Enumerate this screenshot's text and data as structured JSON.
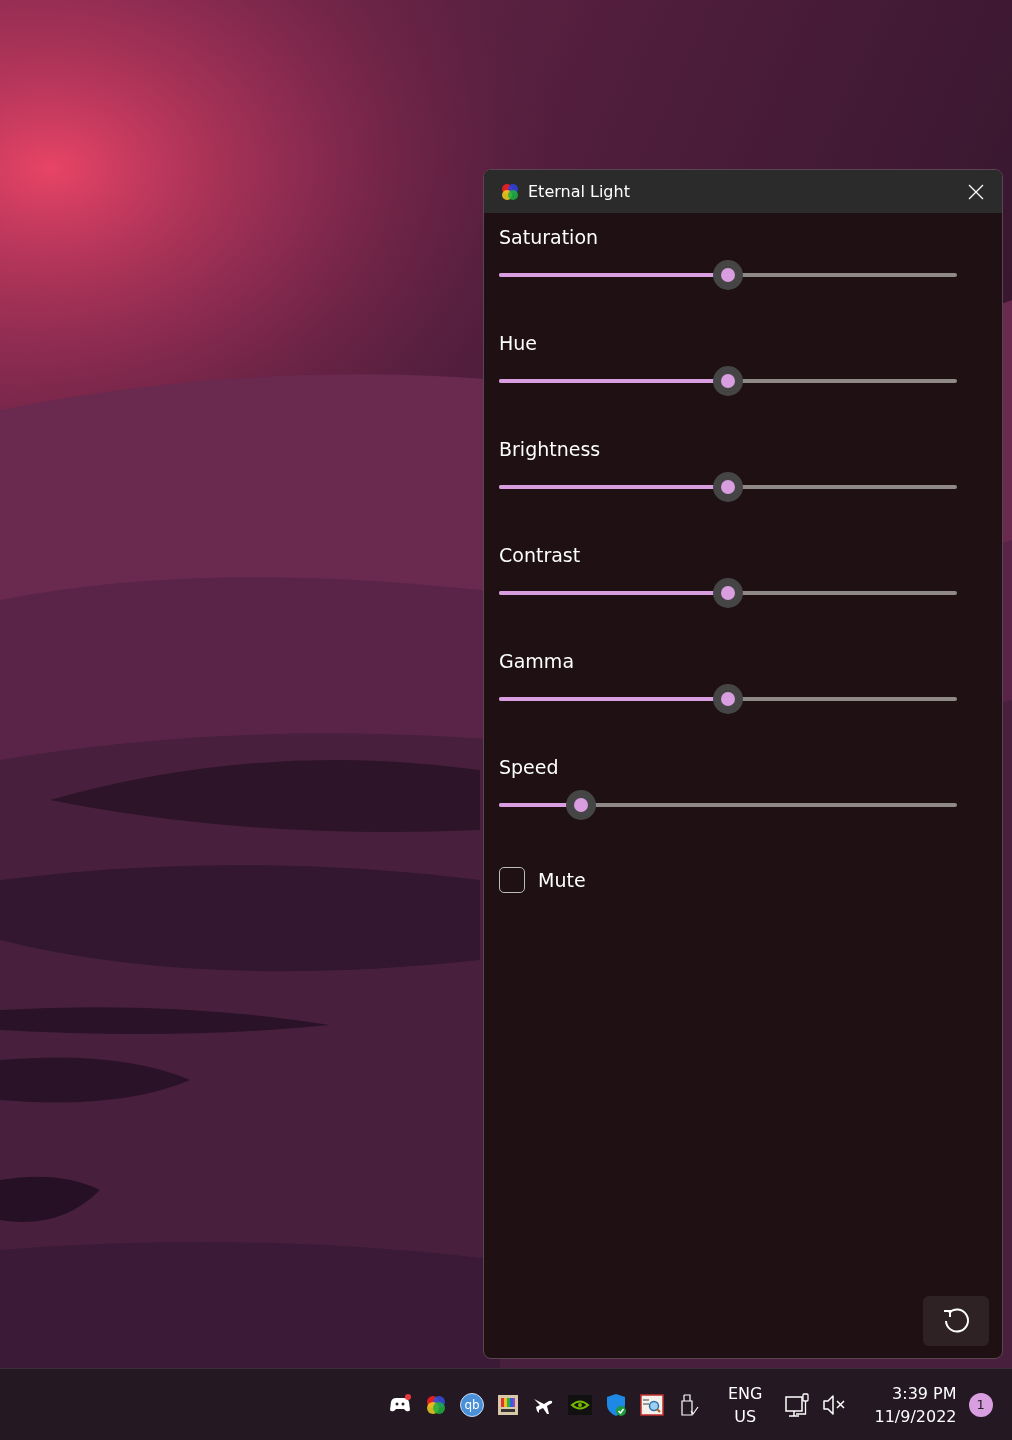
{
  "window": {
    "title": "Eternal Light"
  },
  "sliders": [
    {
      "label": "Saturation",
      "level": 0.5
    },
    {
      "label": "Hue",
      "level": 0.5
    },
    {
      "label": "Brightness",
      "level": 0.5
    },
    {
      "label": "Contrast",
      "level": 0.5
    },
    {
      "label": "Gamma",
      "level": 0.5
    },
    {
      "label": "Speed",
      "level": 0.18
    }
  ],
  "mute": {
    "label": "Mute",
    "checked": false
  },
  "taskbar": {
    "tray": [
      {
        "kind": "controller"
      },
      {
        "kind": "flower"
      },
      {
        "kind": "ball",
        "label": "qb"
      },
      {
        "kind": "palette"
      },
      {
        "kind": "plane"
      },
      {
        "kind": "chip"
      },
      {
        "kind": "shield"
      },
      {
        "kind": "viewer"
      },
      {
        "kind": "usb"
      }
    ],
    "language": [
      "ENG",
      "US"
    ],
    "time": "3:39 PM",
    "date": "11/9/2022",
    "notifications": "1"
  }
}
